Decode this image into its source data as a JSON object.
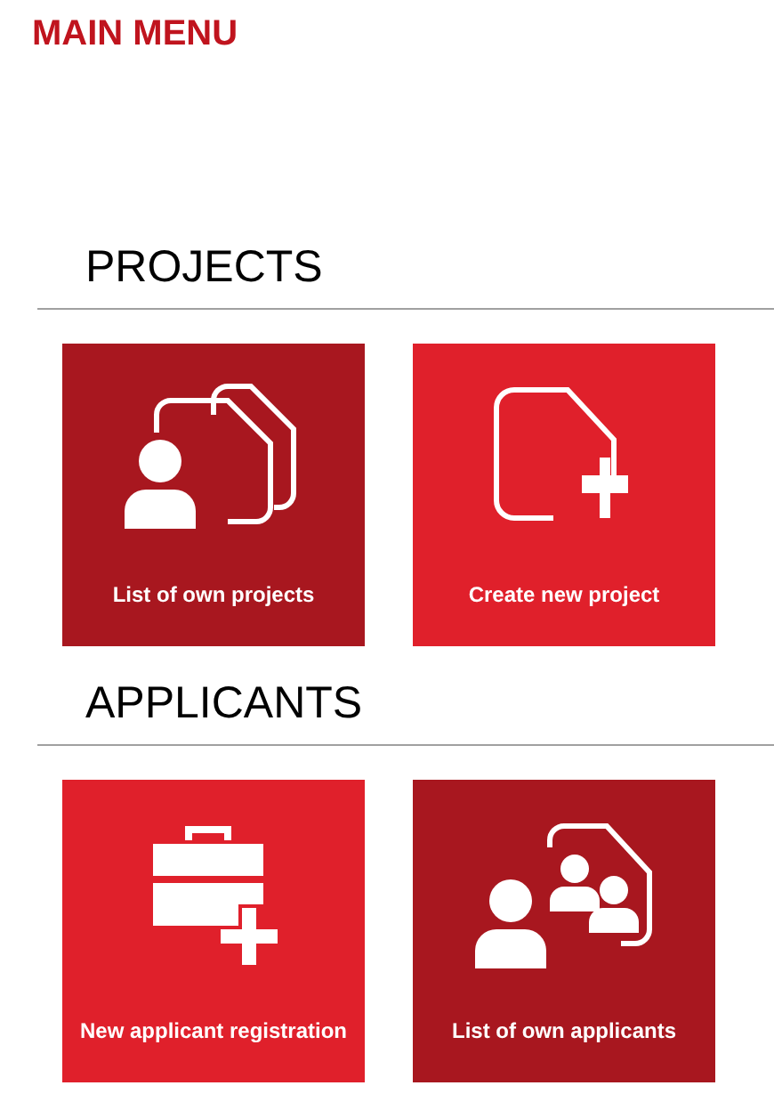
{
  "title": "MAIN MENU",
  "sections": [
    {
      "heading": "PROJECTS",
      "tiles": [
        {
          "label": "List of own projects",
          "color": "#a8171f",
          "kind": "person-stack"
        },
        {
          "label": "Create new project",
          "color": "#e0202b",
          "kind": "document-plus"
        }
      ]
    },
    {
      "heading": "APPLICANTS",
      "tiles": [
        {
          "label": "New applicant registration",
          "color": "#e0202b",
          "kind": "briefcase-plus"
        },
        {
          "label": "List of own applicants",
          "color": "#a8171f",
          "kind": "people-document"
        }
      ]
    }
  ]
}
